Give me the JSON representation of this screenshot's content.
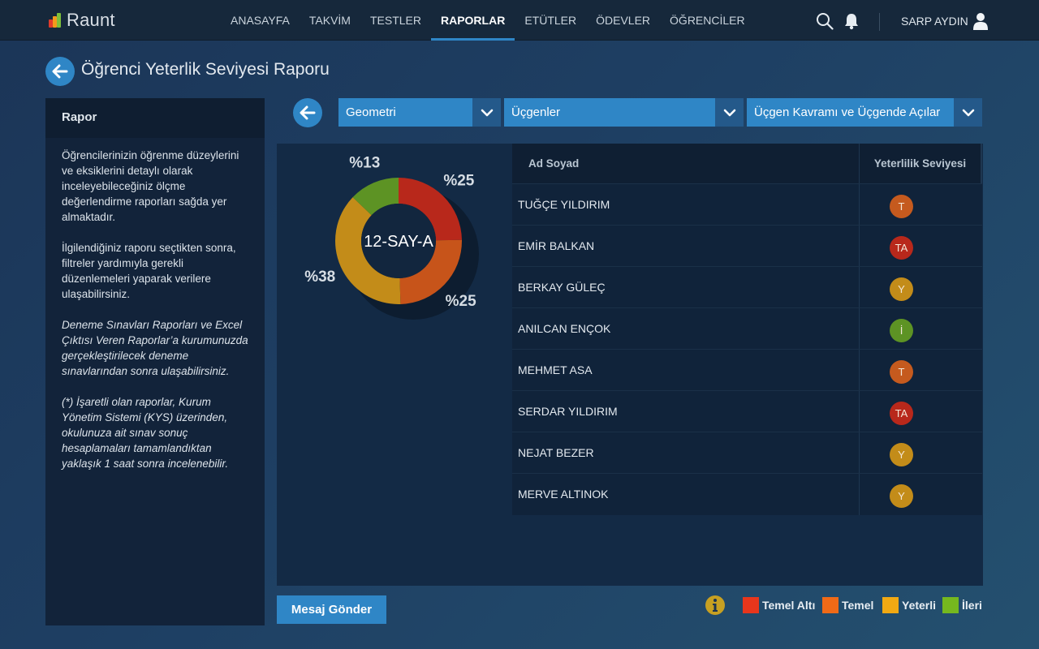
{
  "app": {
    "logo_text": "Raunt"
  },
  "nav": {
    "items": [
      {
        "label": "ANASAYFA"
      },
      {
        "label": "TAKVİM"
      },
      {
        "label": "TESTLER"
      },
      {
        "label": "RAPORLAR",
        "active": true
      },
      {
        "label": "ETÜTLER"
      },
      {
        "label": "ÖDEVLER"
      },
      {
        "label": "ÖĞRENCİLER"
      }
    ],
    "user_name": "SARP AYDIN"
  },
  "page": {
    "title": "Öğrenci Yeterlik Seviyesi Raporu"
  },
  "sidebar": {
    "title": "Rapor",
    "paragraphs": [
      "Öğrencilerinizin öğrenme düzeylerini ve eksiklerini detaylı olarak inceleyebileceğiniz ölçme değerlendirme raporları sağda yer almaktadır.",
      "İlgilendiğiniz raporu seçtikten sonra, filtreler yardımıyla gerekli düzenlemeleri yaparak verilere ulaşabilirsiniz.",
      "Deneme Sınavları Raporları ve Excel Çıktısı Veren Raporlar’a kurumunuzda gerçekleştirilecek deneme sınavlarından sonra ulaşabilirsiniz.",
      "(*) İşaretli olan raporlar, Kurum Yönetim Sistemi (KYS) üzerinden, okulunuza ait sınav sonuç hesaplamaları tamamlandıktan yaklaşık 1 saat sonra incelenebilir."
    ]
  },
  "filters": {
    "subject": "Geometri",
    "unit": "Üçgenler",
    "topic": "Üçgen Kavramı ve Üçgende Açılar"
  },
  "chart_data": {
    "type": "pie",
    "center_label": "12-SAY-A",
    "categories": [
      "Temel Altı",
      "Temel",
      "Yeterli",
      "İleri"
    ],
    "values": [
      25,
      25,
      38,
      13
    ],
    "labels": [
      "%25",
      "%25",
      "%38",
      "%13"
    ],
    "colors": [
      "#b8281b",
      "#c7541a",
      "#c38c19",
      "#5d9324"
    ]
  },
  "table": {
    "headers": {
      "name": "Ad Soyad",
      "level": "Yeterlilik Seviyesi"
    },
    "rows": [
      {
        "name": "TUĞÇE YILDIRIM",
        "level": "T",
        "color": "#c55a1e"
      },
      {
        "name": "EMİR BALKAN",
        "level": "TA",
        "color": "#b8281b"
      },
      {
        "name": "BERKAY GÜLEÇ",
        "level": "Y",
        "color": "#c38c19"
      },
      {
        "name": "ANILCAN ENÇOK",
        "level": "İ",
        "color": "#5d9324"
      },
      {
        "name": "MEHMET ASA",
        "level": "T",
        "color": "#c55a1e"
      },
      {
        "name": "SERDAR YILDIRIM",
        "level": "TA",
        "color": "#b8281b"
      },
      {
        "name": "NEJAT BEZER",
        "level": "Y",
        "color": "#c38c19"
      },
      {
        "name": "MERVE ALTINOK",
        "level": "Y",
        "color": "#c38c19"
      }
    ]
  },
  "actions": {
    "send_message": "Mesaj Gönder"
  },
  "legend": [
    {
      "label": "Temel Altı",
      "color": "#e8361c"
    },
    {
      "label": "Temel",
      "color": "#f06a17"
    },
    {
      "label": "Yeterli",
      "color": "#f2a913"
    },
    {
      "label": "İleri",
      "color": "#75b81f"
    }
  ]
}
